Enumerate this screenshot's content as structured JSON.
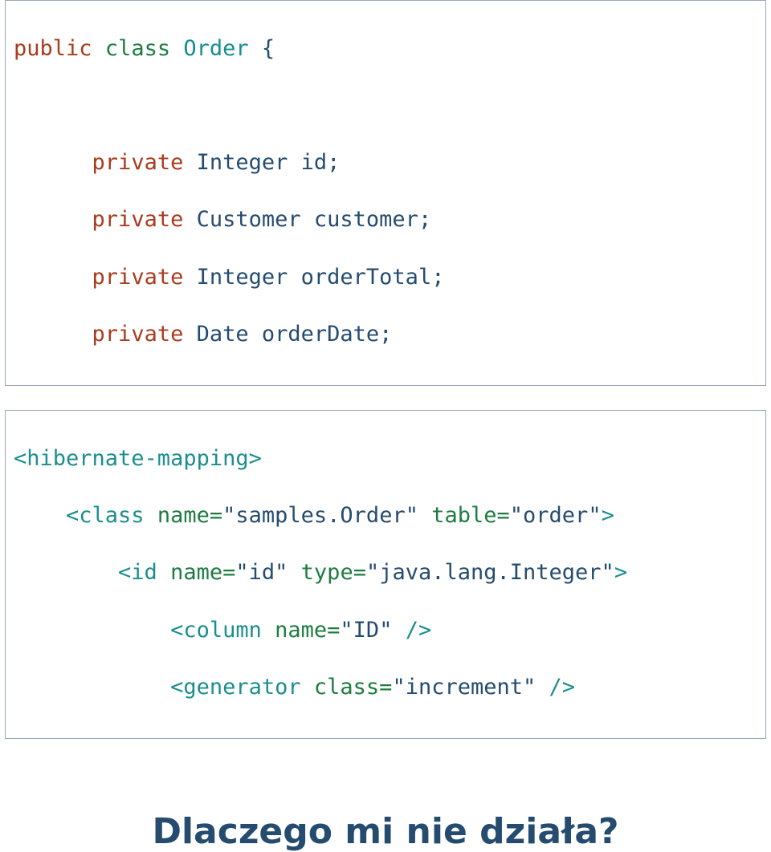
{
  "box1": {
    "l1": {
      "t1": "public",
      "t2": " ",
      "t3": "class",
      "t4": " ",
      "t5": "Order",
      "t6": " {"
    },
    "blank": " ",
    "l2": {
      "indent": "      ",
      "t1": "private",
      "t2": " Integer id;"
    },
    "l3": {
      "indent": "      ",
      "t1": "private",
      "t2": " Customer customer;"
    },
    "l4": {
      "indent": "      ",
      "t1": "private",
      "t2": " Integer orderTotal;"
    },
    "l5": {
      "indent": "      ",
      "t1": "private",
      "t2": " Date orderDate;"
    }
  },
  "box2": {
    "l1": {
      "t1": "<hibernate-mapping>"
    },
    "l2": {
      "indent": "    ",
      "t1": "<class",
      "t2": " ",
      "t3": "name=",
      "t4": "\"samples.Order\"",
      "t5": " ",
      "t6": "table=",
      "t7": "\"order\"",
      "t8": ">"
    },
    "l3": {
      "indent": "        ",
      "t1": "<id",
      "t2": " ",
      "t3": "name=",
      "t4": "\"id\"",
      "t5": " ",
      "t6": "type=",
      "t7": "\"java.lang.Integer\"",
      "t8": ">"
    },
    "l4": {
      "indent": "            ",
      "t1": "<column",
      "t2": " ",
      "t3": "name=",
      "t4": "\"ID\"",
      "t5": " />"
    },
    "l5": {
      "indent": "            ",
      "t1": "<generator",
      "t2": " ",
      "t3": "class=",
      "t4": "\"increment\"",
      "t5": " />"
    }
  },
  "heading": "Dlaczego mi nie działa?"
}
